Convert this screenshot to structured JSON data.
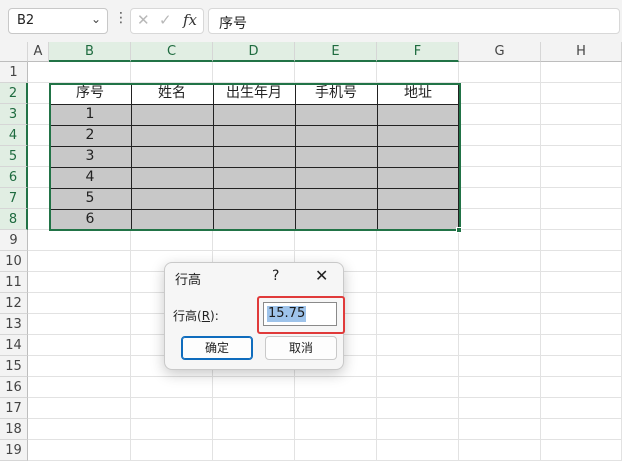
{
  "formula_bar": {
    "name_box": "B2",
    "chevron": "⌄",
    "dots": "⋮",
    "cancel_icon": "✕",
    "enter_icon": "✓",
    "fx_icon": "fx",
    "formula": "序号"
  },
  "columns": [
    "A",
    "B",
    "C",
    "D",
    "E",
    "F",
    "G",
    "H"
  ],
  "rows": [
    "1",
    "2",
    "3",
    "4",
    "5",
    "6",
    "7",
    "8",
    "9",
    "10",
    "11",
    "12",
    "13",
    "14",
    "15",
    "16",
    "17",
    "18",
    "19"
  ],
  "table": {
    "headers": [
      "序号",
      "姓名",
      "出生年月",
      "手机号",
      "地址"
    ],
    "serial_numbers": [
      "1",
      "2",
      "3",
      "4",
      "5",
      "6"
    ]
  },
  "dialog": {
    "title": "行高",
    "help": "?",
    "close": "✕",
    "label_prefix": "行高(",
    "label_key": "R",
    "label_suffix": "):",
    "value": "15.75",
    "ok": "确定",
    "cancel": "取消"
  },
  "colors": {
    "selection": "#217346",
    "table_fill": "#c8c8c8",
    "highlight": "#e03a3a",
    "primary_button": "#0f6cbd"
  }
}
